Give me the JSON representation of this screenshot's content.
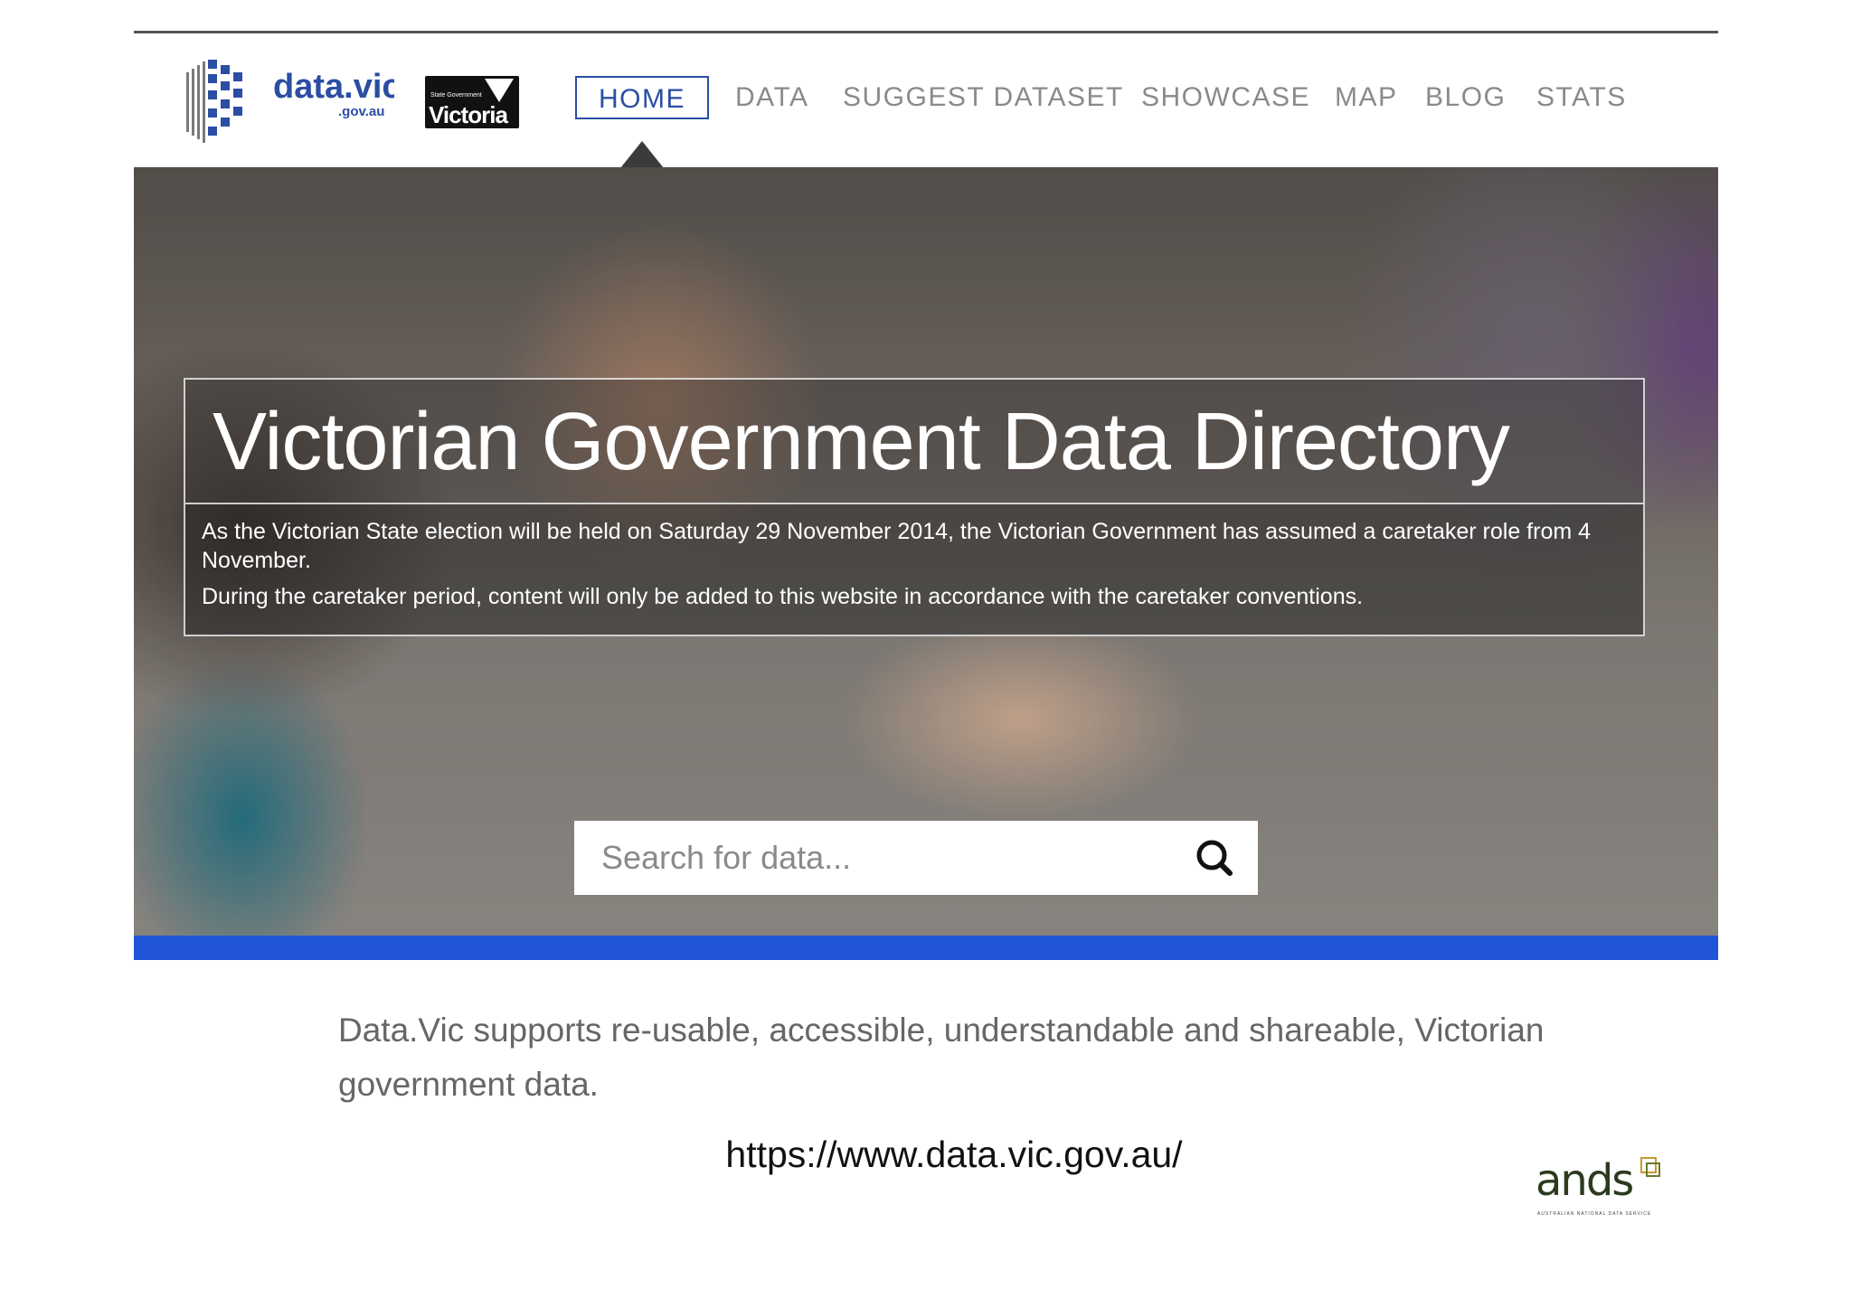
{
  "header": {
    "logo_text": "data.vic",
    "logo_sub": ".gov.au",
    "state_logo_small": "State Government",
    "state_logo_text": "Victoria"
  },
  "nav": {
    "items": [
      {
        "label": "HOME",
        "active": true
      },
      {
        "label": "DATA",
        "active": false
      },
      {
        "label": "SUGGEST DATASET",
        "active": false
      },
      {
        "label": "SHOWCASE",
        "active": false
      },
      {
        "label": "MAP",
        "active": false
      },
      {
        "label": "BLOG",
        "active": false
      },
      {
        "label": "STATS",
        "active": false
      }
    ]
  },
  "hero": {
    "title": "Victorian Government Data Directory",
    "notice_line1": "As the Victorian State election will be held on Saturday 29 November 2014, the Victorian Government has assumed a caretaker role from 4 November.",
    "notice_line2": "During the caretaker period, content will only be added to this website in accordance with the caretaker conventions."
  },
  "search": {
    "placeholder": "Search for data...",
    "icon": "search-icon"
  },
  "tagline": "Data.Vic supports re-usable, accessible, understandable and shareable, Victorian government data.",
  "url": "https://www.data.vic.gov.au/",
  "ands": {
    "text": "ands",
    "sub": "AUSTRALIAN NATIONAL DATA SERVICE"
  },
  "colors": {
    "accent": "#2b4ea3",
    "blue_bar": "#1f55d6",
    "nav_text": "#8a8a8a"
  }
}
